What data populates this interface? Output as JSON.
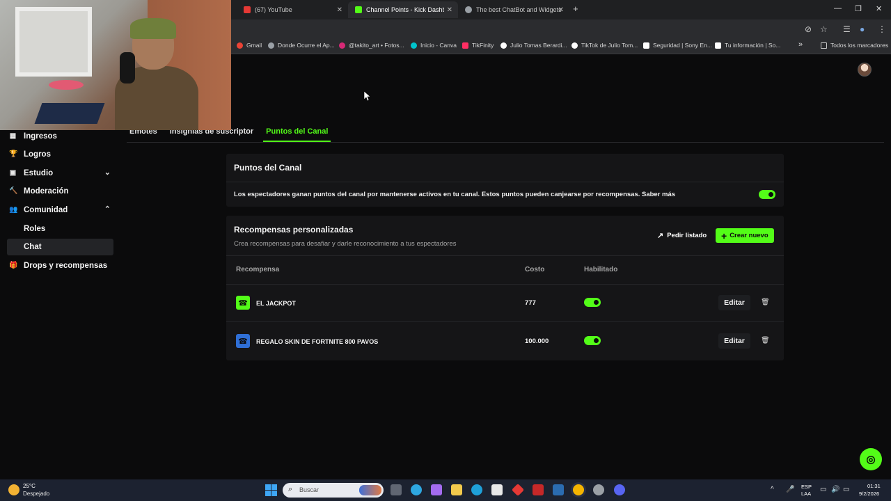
{
  "browser": {
    "tabs": [
      {
        "title": "(67) YouTube",
        "color": "#e53935"
      },
      {
        "title": "Channel Points - Kick Dashboar",
        "color": "#53fc18"
      },
      {
        "title": "The best ChatBot and Widgets",
        "color": "#9aa0a6"
      }
    ],
    "new_tab_symbol": "+",
    "window_controls": {
      "minimize": "—",
      "maximize": "❐",
      "close": "✕"
    },
    "bookmarks": [
      {
        "label": "Gmail",
        "color": "#ea4335"
      },
      {
        "label": "Donde Ocurre el Ap...",
        "color": "#9aa0a6"
      },
      {
        "label": "@takito_art • Fotos...",
        "color": "#d62976"
      },
      {
        "label": "Inicio - Canva",
        "color": "#00c4cc"
      },
      {
        "label": "TikFinity",
        "color": "#ff2e63"
      },
      {
        "label": "Julio Tomas Berardi...",
        "color": "#ffffff"
      },
      {
        "label": "TikTok de Julio Tom...",
        "color": "#ffffff"
      },
      {
        "label": "Seguridad | Sony En...",
        "color": "#ffffff"
      },
      {
        "label": "Tu información | So...",
        "color": "#ffffff"
      },
      {
        "label": "Todos los marcadores",
        "color": "#c9c9c9"
      }
    ],
    "bookmarks_overflow": "»"
  },
  "sidebar": {
    "items": [
      {
        "label": "Ingresos",
        "icon": "▦",
        "chevron": ""
      },
      {
        "label": "Logros",
        "icon": "🏆",
        "chevron": ""
      },
      {
        "label": "Estudio",
        "icon": "▣",
        "chevron": "⌄"
      },
      {
        "label": "Moderación",
        "icon": "🔨",
        "chevron": ""
      },
      {
        "label": "Comunidad",
        "icon": "👥",
        "chevron": "⌃"
      },
      {
        "label": "Roles",
        "icon": "",
        "chevron": ""
      },
      {
        "label": "Chat",
        "icon": "",
        "chevron": ""
      },
      {
        "label": "Drops y recompensas",
        "icon": "🎁",
        "chevron": ""
      }
    ]
  },
  "subtabs": [
    {
      "label": "Emotes"
    },
    {
      "label": "Insignias de suscriptor"
    },
    {
      "label": "Puntos del Canal"
    }
  ],
  "channel_points": {
    "title": "Puntos del Canal",
    "description": "Los espectadores ganan puntos del canal por mantenerse activos en tu canal. Estos puntos pueden canjearse por recompensas. Saber más",
    "enabled": true
  },
  "rewards": {
    "title": "Recompensas personalizadas",
    "subtitle": "Crea recompensas para desafiar y darle reconocimiento a tus espectadores",
    "request_list_label": "Pedir listado",
    "create_label": "Crear nuevo",
    "columns": {
      "reward": "Recompensa",
      "cost": "Costo",
      "enabled": "Habilitado"
    },
    "rows": [
      {
        "name": "EL JACKPOT",
        "cost": "777",
        "enabled": true,
        "edit_label": "Editar",
        "icon_color": "#53fc18"
      },
      {
        "name": "REGALO SKIN DE FORTNITE 800 PAVOS",
        "cost": "100.000",
        "enabled": true,
        "edit_label": "Editar",
        "icon_color": "#2f6fd6"
      }
    ]
  },
  "taskbar": {
    "weather_temp": "25°C",
    "weather_desc": "Despejado",
    "search_placeholder": "Buscar",
    "lang_top": "ESP",
    "lang_bottom": "LAA",
    "time": "01:31",
    "date": "9/2/2026"
  }
}
